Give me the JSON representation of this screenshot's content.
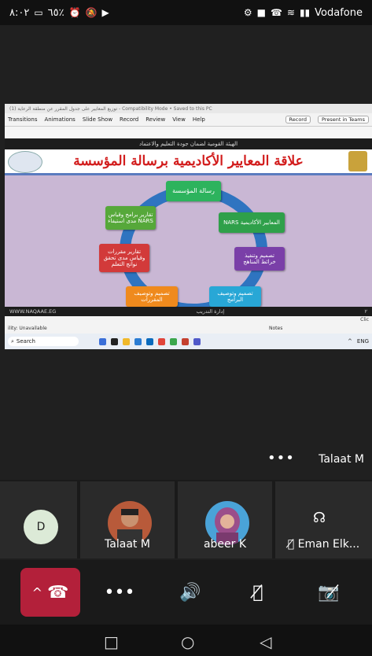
{
  "status_bar": {
    "time": "٨:٠٢",
    "battery": "٦٥٪",
    "carrier": "Vodafone"
  },
  "shared_screen": {
    "ppt_title": "توزيع المعايير على جدول المقرر عن منطقة الرعاية (1) - Compatibility Mode • Saved to this PC",
    "ribbon_tabs": [
      "Transitions",
      "Animations",
      "Slide Show",
      "Record",
      "Review",
      "View",
      "Help"
    ],
    "record_btn": "Record",
    "present_btn": "Present in Teams",
    "slide": {
      "header": "الهيئة القومية لضمان جودة التعليم والاعتماد",
      "title": "علاقة المعايير الأكاديمية برسالة المؤسسة",
      "boxes": [
        {
          "label": "رسالة المؤسسة",
          "color": "#2db35d"
        },
        {
          "label": "NARS المعايير الأكاديمية",
          "color": "#2fa04a"
        },
        {
          "label": "تصميم وتنفيذ خرائط المناهج",
          "color": "#7a3fa8"
        },
        {
          "label": "تصميم وتوصيف البرامج",
          "color": "#28a7d6"
        },
        {
          "label": "تصميم وتوصيف المقررات",
          "color": "#ef8a1d"
        },
        {
          "label": "تقارير مقررات وقياس مدى تحقق نواتج التعلم",
          "color": "#d23a3a"
        },
        {
          "label": "تقارير برامج وقياس مدى استيفاء NARS",
          "color": "#56a83a"
        }
      ],
      "footer_left": "WWW.NAQAAE.EG",
      "footer_center": "إدارة التدريب",
      "footer_page": "٢"
    },
    "status_left": "ility: Unavailable",
    "status_notes": "Notes",
    "status_right": "Clic",
    "taskbar_search": "Search",
    "taskbar_lang": "ENG"
  },
  "speaker": {
    "name": "Talaat M",
    "more": "•••"
  },
  "participants": [
    {
      "name": "",
      "initial": "D",
      "avatar": "initial-avatar"
    },
    {
      "name": "Talaat M",
      "avatar": "photo-man"
    },
    {
      "name": "abeer K",
      "avatar": "photo-woman"
    },
    {
      "name": "Eman Elk...",
      "avatar": "headset-icon",
      "muted": true
    }
  ],
  "controls": {
    "end_call": "end-call",
    "more": "•••",
    "speaker": "speaker-icon",
    "mic": "mic-off-icon",
    "camera": "camera-off-icon"
  },
  "nav": {
    "recent": "□",
    "home": "○",
    "back": "◁"
  }
}
